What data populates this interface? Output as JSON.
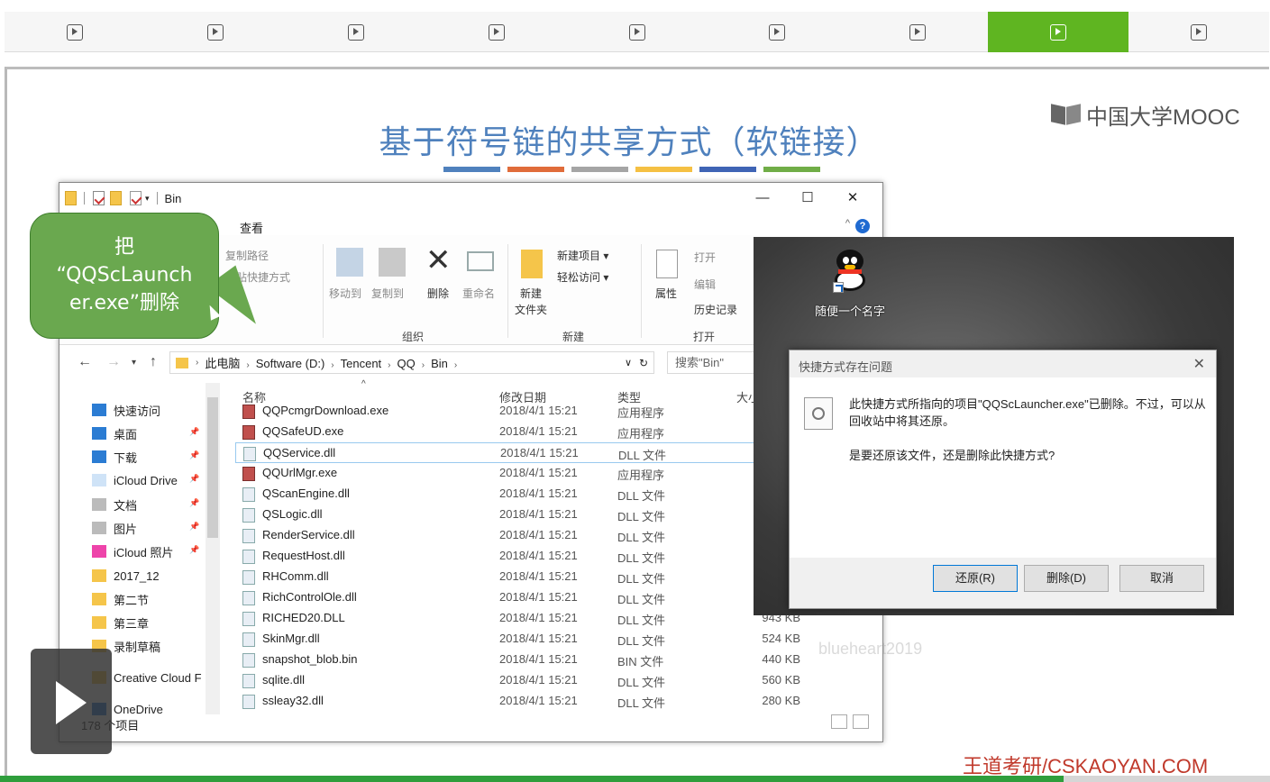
{
  "topnav": {
    "count": 9,
    "active_index": 7,
    "accent": "#5fb521"
  },
  "slide": {
    "title": "基于符号链的共享方式（软链接）",
    "title_color": "#4f81bd",
    "title_bar_colors": [
      "#4f81bd",
      "#e06c3a",
      "#a5a5a5",
      "#f5c043",
      "#3f64b5",
      "#70ad47"
    ],
    "logo_text": "中国大学MOOC",
    "footer_brand": "王道考研/CSKAOYAN.COM",
    "watermark": "blueheart2019"
  },
  "callout": {
    "line1": "把",
    "line2": "“QQScLaunch",
    "line3": "er.exe”删除"
  },
  "explorer": {
    "title": "Bin",
    "tab_view": "查看",
    "ribbon": {
      "copy_path": "复制路径",
      "paste_shortcut": "粘贴快捷方式",
      "move_to": "移动到",
      "copy_to": "复制到",
      "delete": "删除",
      "rename": "重命名",
      "new_folder_1": "新建",
      "new_folder_2": "文件夹",
      "new_item": "新建项目",
      "easy_access": "轻松访问",
      "properties": "属性",
      "open": "打开",
      "edit": "编辑",
      "history": "历史记录",
      "group_organize": "组织",
      "group_new": "新建",
      "group_open": "打开"
    },
    "address": {
      "crumbs": [
        "此电脑",
        "Software (D:)",
        "Tencent",
        "QQ",
        "Bin"
      ],
      "search_placeholder": "搜索\"Bin\""
    },
    "nav": [
      {
        "label": "快速访问",
        "pin": false
      },
      {
        "label": "桌面",
        "pin": true
      },
      {
        "label": "下载",
        "pin": true
      },
      {
        "label": "iCloud Drive",
        "pin": true
      },
      {
        "label": "文档",
        "pin": true
      },
      {
        "label": "图片",
        "pin": true
      },
      {
        "label": "iCloud 照片",
        "pin": true
      },
      {
        "label": "2017_12",
        "pin": false
      },
      {
        "label": "第二节",
        "pin": false
      },
      {
        "label": "第三章",
        "pin": false
      },
      {
        "label": "录制草稿",
        "pin": false
      },
      {
        "label": "Creative Cloud F",
        "pin": false
      },
      {
        "label": "OneDrive",
        "pin": false
      }
    ],
    "columns": {
      "name": "名称",
      "date": "修改日期",
      "type": "类型",
      "size": "大小"
    },
    "files": [
      {
        "name": "QQPcmgrDownload.exe",
        "date": "2018/4/1 15:21",
        "type": "应用程序",
        "size": ""
      },
      {
        "name": "QQSafeUD.exe",
        "date": "2018/4/1 15:21",
        "type": "应用程序",
        "size": ""
      },
      {
        "name": "QQService.dll",
        "date": "2018/4/1 15:21",
        "type": "DLL 文件",
        "size": ""
      },
      {
        "name": "QQUrlMgr.exe",
        "date": "2018/4/1 15:21",
        "type": "应用程序",
        "size": ""
      },
      {
        "name": "QScanEngine.dll",
        "date": "2018/4/1 15:21",
        "type": "DLL 文件",
        "size": ""
      },
      {
        "name": "QSLogic.dll",
        "date": "2018/4/1 15:21",
        "type": "DLL 文件",
        "size": ""
      },
      {
        "name": "RenderService.dll",
        "date": "2018/4/1 15:21",
        "type": "DLL 文件",
        "size": ""
      },
      {
        "name": "RequestHost.dll",
        "date": "2018/4/1 15:21",
        "type": "DLL 文件",
        "size": ""
      },
      {
        "name": "RHComm.dll",
        "date": "2018/4/1 15:21",
        "type": "DLL 文件",
        "size": ""
      },
      {
        "name": "RichControlOle.dll",
        "date": "2018/4/1 15:21",
        "type": "DLL 文件",
        "size": ""
      },
      {
        "name": "RICHED20.DLL",
        "date": "2018/4/1 15:21",
        "type": "DLL 文件",
        "size": "943 KB"
      },
      {
        "name": "SkinMgr.dll",
        "date": "2018/4/1 15:21",
        "type": "DLL 文件",
        "size": "524 KB"
      },
      {
        "name": "snapshot_blob.bin",
        "date": "2018/4/1 15:21",
        "type": "BIN 文件",
        "size": "440 KB"
      },
      {
        "name": "sqlite.dll",
        "date": "2018/4/1 15:21",
        "type": "DLL 文件",
        "size": "560 KB"
      },
      {
        "name": "ssleay32.dll",
        "date": "2018/4/1 15:21",
        "type": "DLL 文件",
        "size": "280 KB"
      }
    ],
    "selected_index": 2,
    "status": "178 个项目"
  },
  "desktop": {
    "shortcut_label": "随便一个名字"
  },
  "dialog": {
    "title": "快捷方式存在问题",
    "message": "此快捷方式所指向的项目\"QQScLauncher.exe\"已删除。不过，可以从回收站中将其还原。",
    "question": "是要还原该文件，还是删除此快捷方式?",
    "restore_label": "还原(R)",
    "delete_label": "删除(D)",
    "cancel_label": "取消"
  }
}
